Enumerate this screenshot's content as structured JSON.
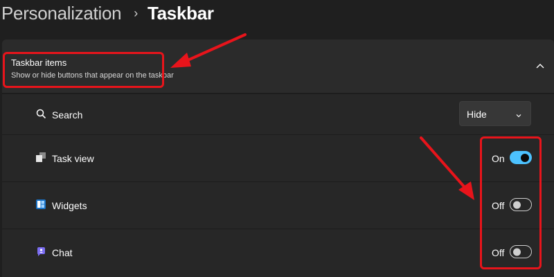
{
  "breadcrumb": {
    "parent": "Personalization",
    "separator": "›",
    "current": "Taskbar"
  },
  "group": {
    "title": "Taskbar items",
    "subtitle": "Show or hide buttons that appear on the taskbar",
    "expanded": true
  },
  "rows": {
    "search": {
      "label": "Search",
      "icon": "search-icon",
      "dropdown_value": "Hide"
    },
    "taskview": {
      "label": "Task view",
      "icon": "task-view-icon",
      "state_label": "On",
      "on": true
    },
    "widgets": {
      "label": "Widgets",
      "icon": "widgets-icon",
      "state_label": "Off",
      "on": false
    },
    "chat": {
      "label": "Chat",
      "icon": "chat-icon",
      "state_label": "Off",
      "on": false
    }
  },
  "colors": {
    "background": "#1f1f1f",
    "card": "#272727",
    "header": "#2b2b2b",
    "accent": "#4cc2ff",
    "annotation": "#e8141b"
  }
}
